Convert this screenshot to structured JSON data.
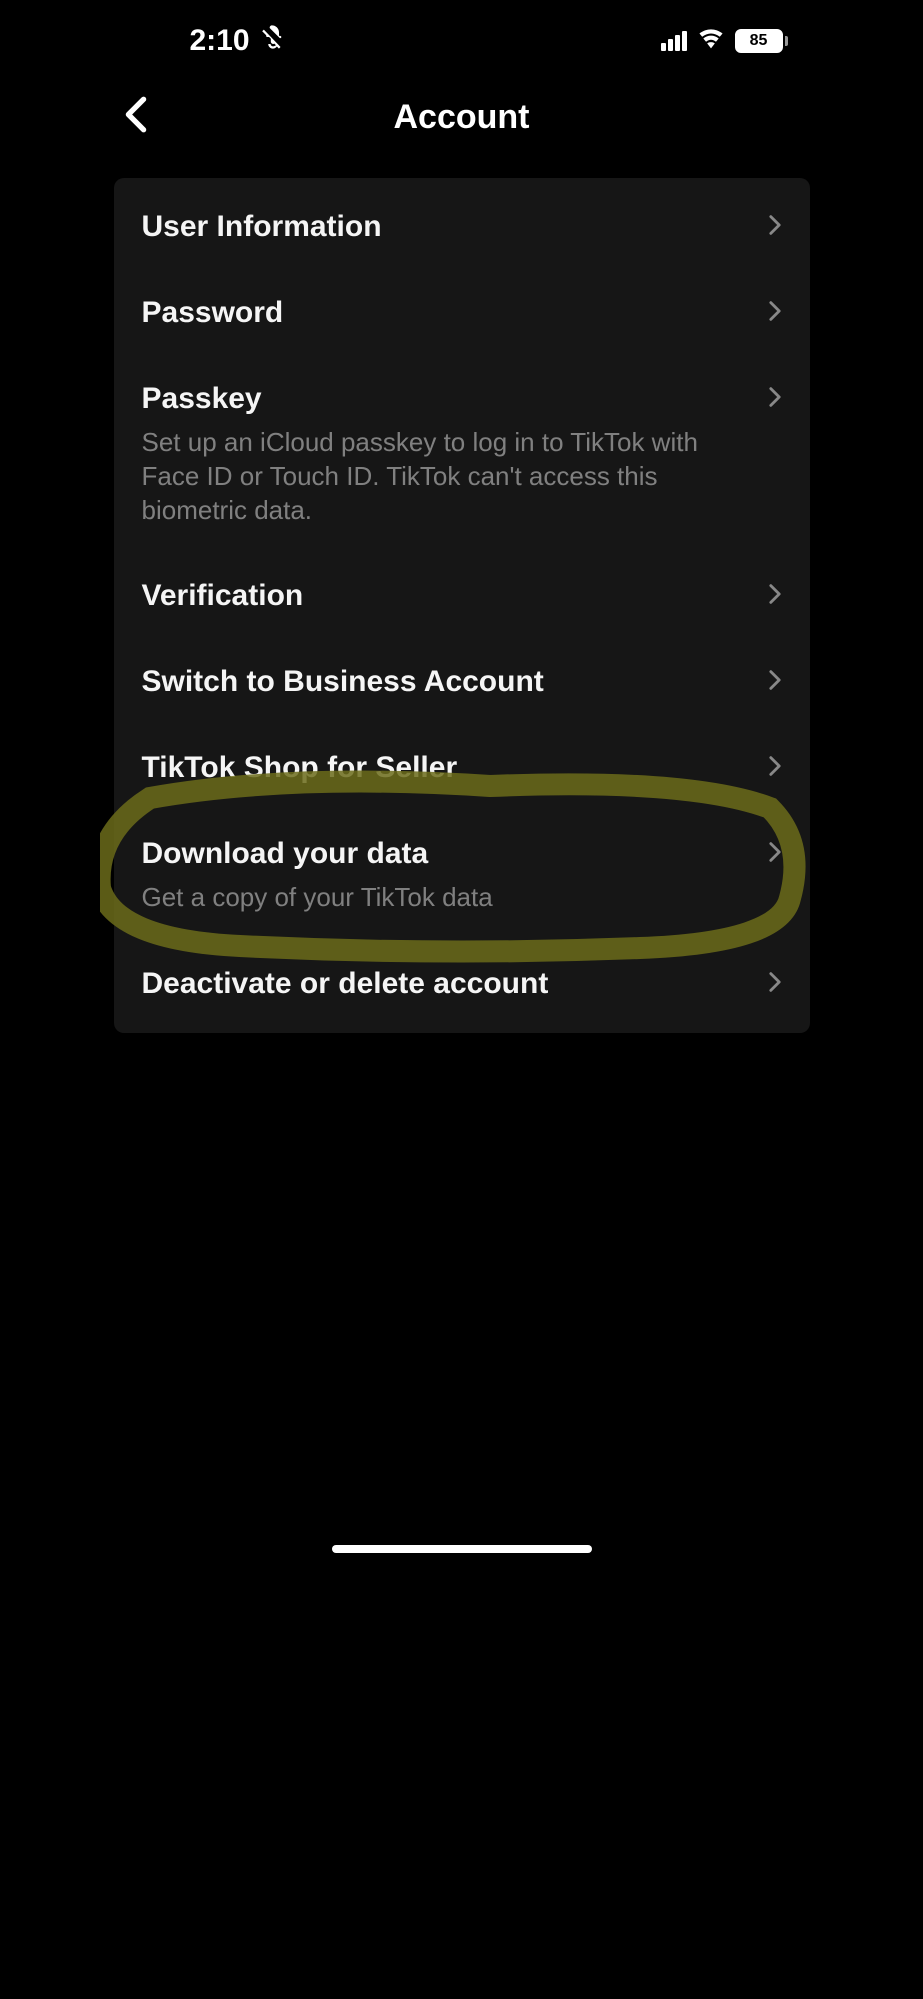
{
  "status": {
    "time": "2:10",
    "battery": "85"
  },
  "header": {
    "title": "Account"
  },
  "items": [
    {
      "label": "User Information",
      "desc": ""
    },
    {
      "label": "Password",
      "desc": ""
    },
    {
      "label": "Passkey",
      "desc": "Set up an iCloud passkey to log in to TikTok with Face ID or Touch ID. TikTok can't access this biometric data."
    },
    {
      "label": "Verification",
      "desc": ""
    },
    {
      "label": "Switch to Business Account",
      "desc": ""
    },
    {
      "label": "TikTok Shop for Seller",
      "desc": ""
    },
    {
      "label": "Download your data",
      "desc": "Get a copy of your TikTok data"
    },
    {
      "label": "Deactivate or delete account",
      "desc": ""
    }
  ]
}
